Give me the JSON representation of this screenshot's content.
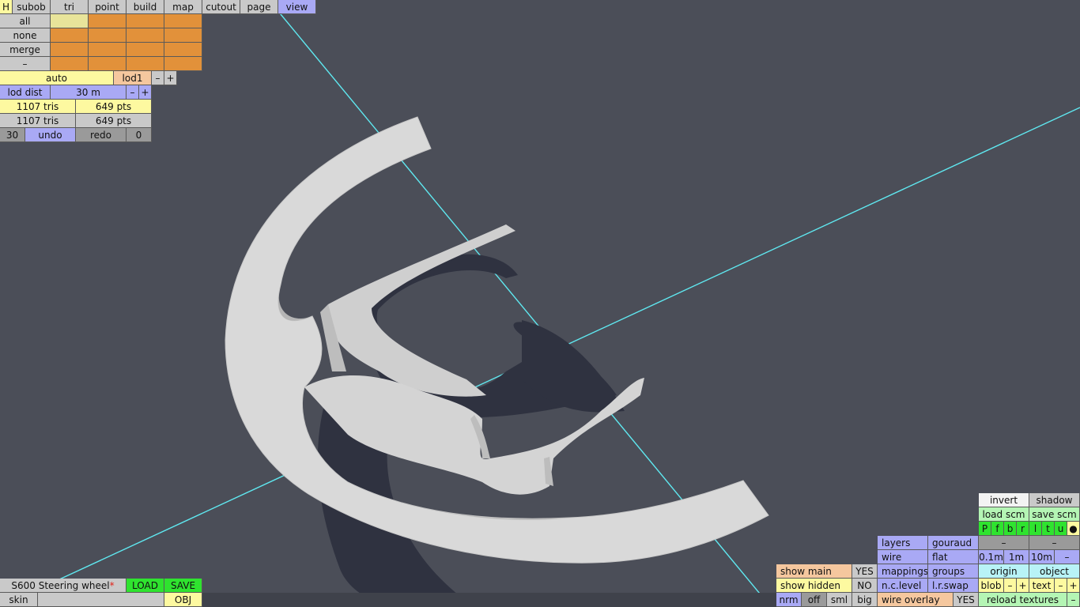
{
  "toolbar": {
    "h": "H",
    "subob": "subob",
    "tri": "tri",
    "point": "point",
    "build": "build",
    "map": "map",
    "cutout": "cutout",
    "page": "page",
    "view": "view"
  },
  "select": {
    "all": "all",
    "none": "none",
    "merge": "merge",
    "minus": "–"
  },
  "lod": {
    "auto": "auto",
    "lod1": "lod1",
    "minus": "–",
    "plus": "+",
    "dist_label": "lod dist",
    "dist_value": "30 m"
  },
  "stats": {
    "row1_tris": "1107 tris",
    "row1_pts": "649 pts",
    "row2_tris": "1107 tris",
    "row2_pts": "649 pts"
  },
  "history": {
    "count": "30",
    "undo": "undo",
    "redo": "redo",
    "redo_count": "0"
  },
  "file": {
    "name": "S600 Steering wheel",
    "modified": "*",
    "load": "LOAD",
    "save": "SAVE",
    "skin": "skin",
    "obj": "OBJ"
  },
  "display": {
    "show_main": "show main",
    "show_main_val": "YES",
    "show_hidden": "show hidden",
    "show_hidden_val": "NO",
    "nrm": "nrm",
    "off": "off",
    "sml": "sml",
    "big": "big",
    "layers": "layers",
    "gouraud": "gouraud",
    "wire": "wire",
    "flat": "flat",
    "mappings": "mappings",
    "groups": "groups",
    "nclevel": "n.c.level",
    "lrswap": "l.r.swap",
    "wire_overlay": "wire overlay",
    "wire_overlay_val": "YES"
  },
  "right": {
    "invert": "invert",
    "shadow": "shadow",
    "load_scm": "load scm",
    "save_scm": "save scm",
    "views": [
      "P",
      "f",
      "b",
      "r",
      "l",
      "t",
      "u",
      "●"
    ],
    "dash": "–",
    "g01": "0.1m",
    "g1": "1m",
    "g10": "10m",
    "origin": "origin",
    "object": "object",
    "blob": "blob",
    "text": "text",
    "minus": "–",
    "plus": "+",
    "reload": "reload textures"
  }
}
